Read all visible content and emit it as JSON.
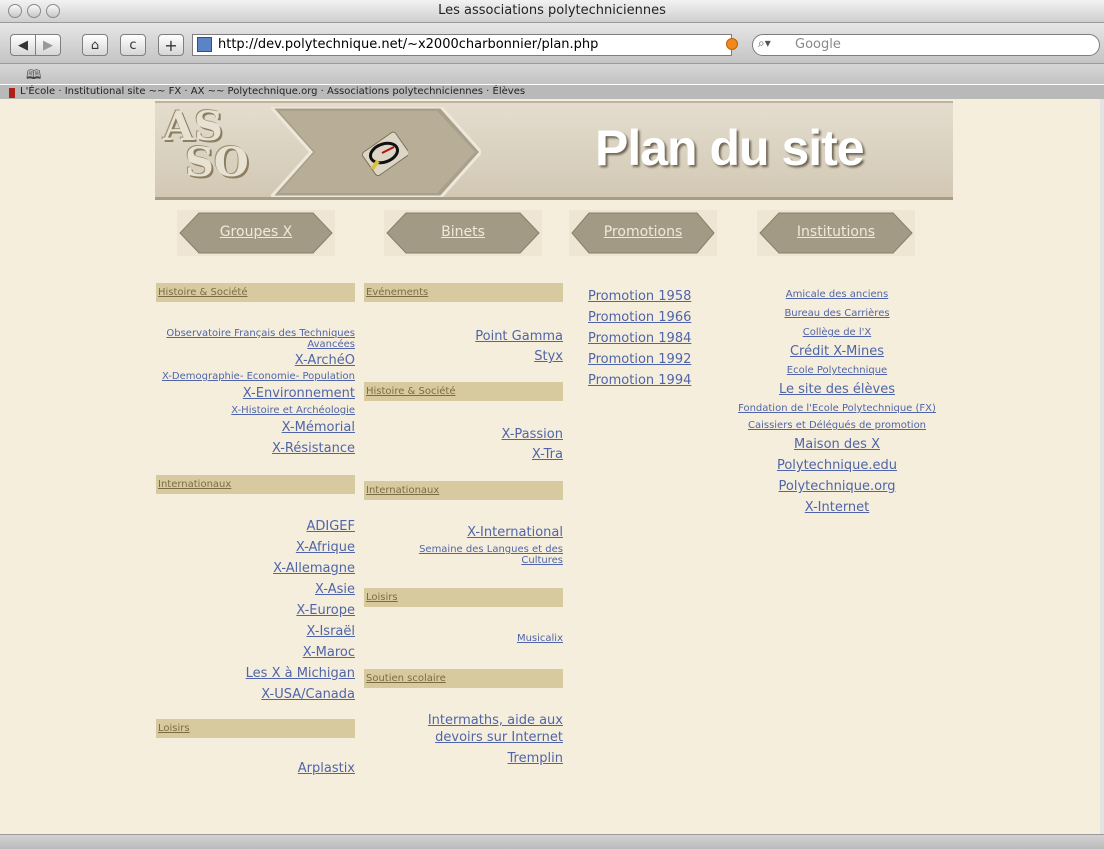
{
  "window": {
    "title": "Les associations polytechniciennes"
  },
  "toolbar": {
    "back_label": "◀",
    "forward_label": "▶",
    "home_label": "⌂",
    "reload_label": "c",
    "add_label": "+",
    "url": "http://dev.polytechnique.net/~x2000charbonnier/plan.php",
    "search_placeholder": "Google"
  },
  "linkbar": {
    "text": "L'École · Institutional site  ~~  FX · AX  ~~  Polytechnique.org · Associations polytechniciennes · Élèves"
  },
  "banner": {
    "logo_line1": "AS",
    "logo_line2": "SO",
    "title": "Plan du site"
  },
  "tabs": [
    "Groupes X",
    "Binets",
    "Promotions",
    "Institutions"
  ],
  "groupes": {
    "sections": [
      {
        "title": "Histoire & Société",
        "links": [
          "Observatoire Français des Techniques Avancées",
          "X-ArchéO",
          "X-Demographie- Economie- Population",
          "X-Environnement",
          "X-Histoire et Archéologie",
          "X-Mémorial",
          "X-Résistance"
        ]
      },
      {
        "title": "Internationaux",
        "links": [
          "ADIGEF",
          "X-Afrique",
          "X-Allemagne",
          "X-Asie",
          "X-Europe",
          "X-Israël",
          "X-Maroc",
          "Les X à Michigan",
          "X-USA/Canada"
        ]
      },
      {
        "title": "Loisirs",
        "links": [
          "Arplastix"
        ]
      }
    ]
  },
  "binets": {
    "sections": [
      {
        "title": "Evénements",
        "links": [
          "Point Gamma",
          "Styx"
        ]
      },
      {
        "title": "Histoire & Société",
        "links": [
          "X-Passion",
          "X-Tra"
        ]
      },
      {
        "title": "Internationaux",
        "links": [
          "X-International",
          "Semaine des Langues et des Cultures"
        ]
      },
      {
        "title": "Loisirs",
        "links": [
          "Musicalix"
        ]
      },
      {
        "title": "Soutien scolaire",
        "links": [
          "Intermaths, aide aux devoirs sur Internet",
          "Tremplin"
        ]
      }
    ]
  },
  "promotions": [
    "Promotion 1958",
    "Promotion 1966",
    "Promotion 1984",
    "Promotion 1992",
    "Promotion 1994"
  ],
  "institutions": [
    "Amicale des anciens",
    "Bureau des Carrières",
    "Collège de l'X",
    "Crédit X-Mines",
    "Ecole Polytechnique",
    "Le site des élèves",
    "Fondation de l'Ecole Polytechnique (FX)",
    "Caissiers et Délégués de promotion",
    "Maison des X",
    "Polytechnique.edu",
    "Polytechnique.org",
    "X-Internet"
  ]
}
